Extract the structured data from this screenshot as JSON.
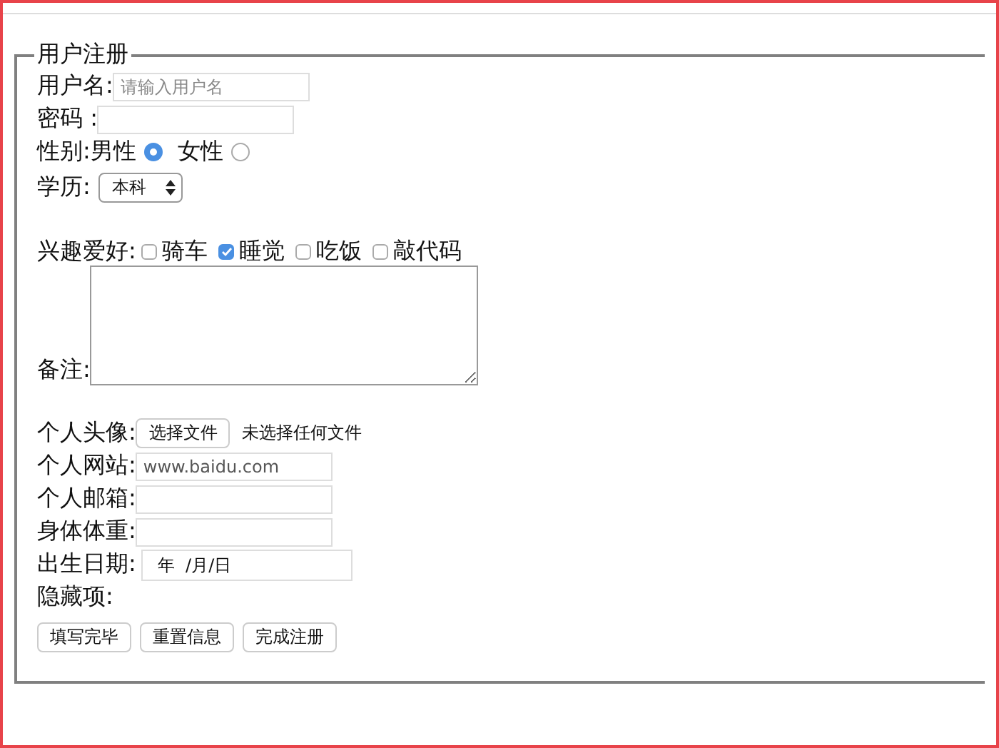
{
  "form": {
    "legend": "用户注册",
    "fields": [
      {
        "kind": "text",
        "label": "用户名:",
        "placeholder": "请输入用户名"
      },
      {
        "kind": "password",
        "label": "密码 :"
      },
      {
        "kind": "radio",
        "label": "性别:",
        "options": [
          {
            "label": "男性",
            "selected": true
          },
          {
            "label": "女性",
            "selected": false
          }
        ]
      },
      {
        "kind": "select",
        "label": "学历:",
        "value": "本科"
      },
      {
        "kind": "checkbox",
        "label": "兴趣爱好:",
        "options": [
          {
            "label": "骑车",
            "checked": false
          },
          {
            "label": "睡觉",
            "checked": true
          },
          {
            "label": "吃饭",
            "checked": false
          },
          {
            "label": "敲代码",
            "checked": false
          }
        ]
      },
      {
        "kind": "textarea",
        "label": "备注:"
      },
      {
        "kind": "file",
        "label": "个人头像:",
        "button": "选择文件",
        "status": "未选择任何文件"
      },
      {
        "kind": "text",
        "label": "个人网站:",
        "value": "www.baidu.com"
      },
      {
        "kind": "text",
        "label": "个人邮箱:"
      },
      {
        "kind": "text",
        "label": "身体体重:"
      },
      {
        "kind": "date",
        "label": "出生日期:",
        "value": "年  /月/日"
      },
      {
        "kind": "hidden",
        "label": "隐藏项:"
      }
    ],
    "buttons": [
      "填写完毕",
      "重置信息",
      "完成注册"
    ]
  }
}
